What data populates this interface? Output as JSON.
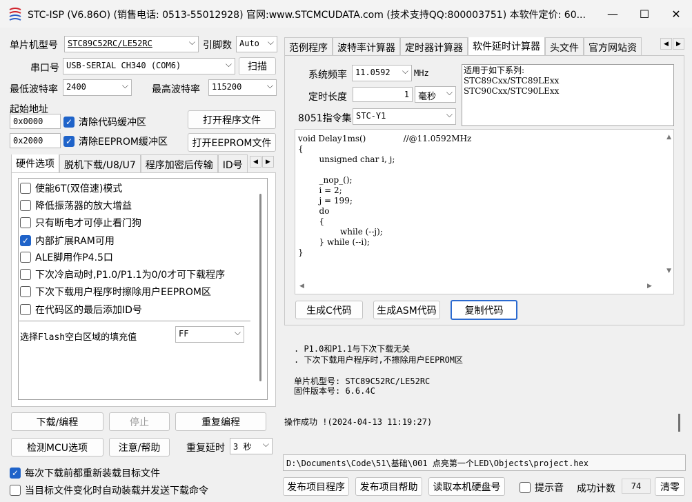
{
  "window": {
    "title": "STC-ISP (V6.86O) (销售电话: 0513-55012928) 官网:www.STCMCUDATA.com  (技术支持QQ:800003751) 本软件定价: 60...",
    "minimize": "—",
    "maximize": "☐",
    "close": "✕"
  },
  "left": {
    "mcu_label": "单片机型号",
    "mcu_value": "STC89C52RC/LE52RC",
    "pins_label": "引脚数",
    "pins_value": "Auto",
    "port_label": "串口号",
    "port_value": "USB-SERIAL CH340 (COM6)",
    "scan_button": "扫描",
    "min_baud_label": "最低波特率",
    "min_baud_value": "2400",
    "max_baud_label": "最高波特率",
    "max_baud_value": "115200",
    "start_addr_label": "起始地址",
    "addr1": "0x0000",
    "clear_code_label": "清除代码缓冲区",
    "open_prog_button": "打开程序文件",
    "addr2": "0x2000",
    "clear_eeprom_label": "清除EEPROM缓冲区",
    "open_eeprom_button": "打开EEPROM文件",
    "tabs": [
      "硬件选项",
      "脱机下载/U8/U7",
      "程序加密后传输",
      "ID号"
    ],
    "options": [
      {
        "label": "使能6T(双倍速)模式",
        "checked": false
      },
      {
        "label": "降低振荡器的放大增益",
        "checked": false
      },
      {
        "label": "只有断电才可停止看门狗",
        "checked": false
      },
      {
        "label": "内部扩展RAM可用",
        "checked": true
      },
      {
        "label": "ALE脚用作P4.5口",
        "checked": false
      },
      {
        "label": "下次冷启动时,P1.0/P1.1为0/0才可下载程序",
        "checked": false
      },
      {
        "label": "下次下载用户程序时擦除用户EEPROM区",
        "checked": false
      },
      {
        "label": "在代码区的最后添加ID号",
        "checked": false
      }
    ],
    "fill_label": "选择Flash空白区域的填充值",
    "fill_value": "FF",
    "download_button": "下载/编程",
    "stop_button": "停止",
    "reprogram_button": "重复编程",
    "detect_button": "检测MCU选项",
    "help_button": "注意/帮助",
    "repeat_delay_label": "重复延时",
    "repeat_delay_value": "3 秒",
    "reload_label": "每次下载前都重新装载目标文件",
    "auto_send_label": "当目标文件变化时自动装载并发送下载命令"
  },
  "right": {
    "tabs": [
      "范例程序",
      "波特率计算器",
      "定时器计算器",
      "软件延时计算器",
      "头文件",
      "官方网站资"
    ],
    "sys_freq_label": "系统频率",
    "sys_freq_value": "11.0592",
    "sys_freq_unit": "MHz",
    "delay_len_label": "定时长度",
    "delay_len_value": "1",
    "delay_unit": "毫秒",
    "isa_label": "8051指令集",
    "isa_value": "STC-Y1",
    "applies_text": "适用于如下系列:\nSTC89Cxx/STC89LExx\nSTC90Cxx/STC90LExx",
    "code": "void Delay1ms()\t\t//@11.0592MHz\n{\n\tunsigned char i, j;\n\n\t_nop_();\n\ti = 2;\n\tj = 199;\n\tdo\n\t{\n\t\twhile (--j);\n\t} while (--i);\n}",
    "gen_c_button": "生成C代码",
    "gen_asm_button": "生成ASM代码",
    "copy_button": "复制代码",
    "log": {
      "line1": ". P1.0和P1.1与下次下载无关",
      "line2": ". 下次下载用户程序时,不擦除用户EEPROM区",
      "mcu_model": "单片机型号: STC89C52RC/LE52RC",
      "fw_version": "固件版本号: 6.6.4C",
      "result": "操作成功 !(2024-04-13 11:19:27)"
    },
    "file_path": "D:\\Documents\\Code\\51\\基础\\001 点亮第一个LED\\Objects\\project.hex",
    "publish_prog_button": "发布项目程序",
    "publish_help_button": "发布项目帮助",
    "read_disk_button": "读取本机硬盘号",
    "sound_label": "提示音",
    "count_label": "成功计数",
    "count_value": "74",
    "clear_button": "清零"
  }
}
